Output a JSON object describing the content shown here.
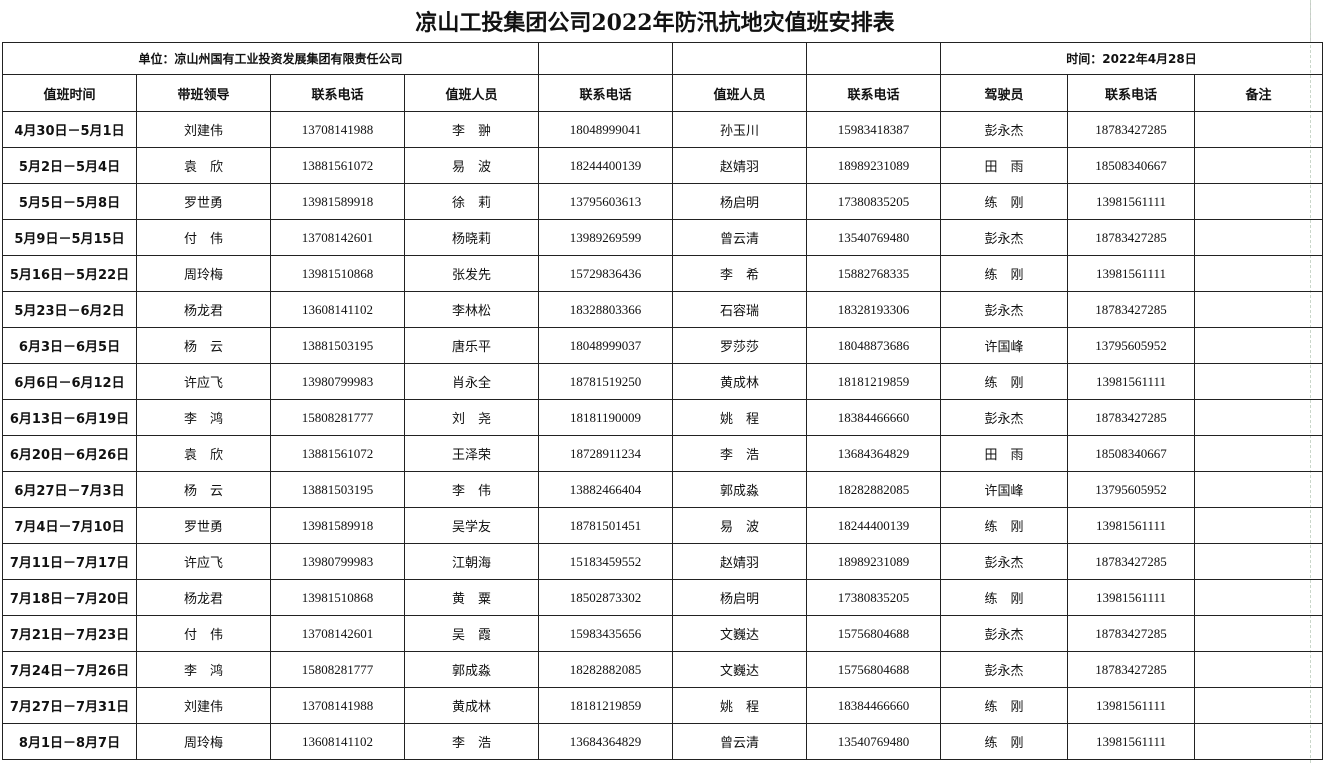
{
  "title": "凉山工投集团公司2022年防汛抗地灾值班安排表",
  "unit": "单位：凉山州国有工业投资发展集团有限责任公司",
  "date": "时间：2022年4月28日",
  "headers": [
    "值班时间",
    "带班领导",
    "联系电话",
    "值班人员",
    "联系电话",
    "值班人员",
    "联系电话",
    "驾驶员",
    "联系电话",
    "备注"
  ],
  "rows": [
    {
      "period": "4月30日－5月1日",
      "leader": "刘建伟",
      "leader_phone": "13708141988",
      "duty1": "李　翀",
      "duty1_phone": "18048999041",
      "duty2": "孙玉川",
      "duty2_phone": "15983418387",
      "driver": "彭永杰",
      "driver_phone": "18783427285",
      "note": ""
    },
    {
      "period": "5月2日－5月4日",
      "leader": "袁　欣",
      "leader_phone": "13881561072",
      "duty1": "易　波",
      "duty1_phone": "18244400139",
      "duty2": "赵婧羽",
      "duty2_phone": "18989231089",
      "driver": "田　雨",
      "driver_phone": "18508340667",
      "note": ""
    },
    {
      "period": "5月5日－5月8日",
      "leader": "罗世勇",
      "leader_phone": "13981589918",
      "duty1": "徐　莉",
      "duty1_phone": "13795603613",
      "duty2": "杨启明",
      "duty2_phone": "17380835205",
      "driver": "练　刚",
      "driver_phone": "13981561111",
      "note": ""
    },
    {
      "period": "5月9日－5月15日",
      "leader": "付　伟",
      "leader_phone": "13708142601",
      "duty1": "杨晓莉",
      "duty1_phone": "13989269599",
      "duty2": "曾云清",
      "duty2_phone": "13540769480",
      "driver": "彭永杰",
      "driver_phone": "18783427285",
      "note": ""
    },
    {
      "period": "5月16日－5月22日",
      "leader": "周玲梅",
      "leader_phone": "13981510868",
      "duty1": "张发先",
      "duty1_phone": "15729836436",
      "duty2": "李　希",
      "duty2_phone": "15882768335",
      "driver": "练　刚",
      "driver_phone": "13981561111",
      "note": ""
    },
    {
      "period": "5月23日－6月2日",
      "leader": "杨龙君",
      "leader_phone": "13608141102",
      "duty1": "李林松",
      "duty1_phone": "18328803366",
      "duty2": "石容瑞",
      "duty2_phone": "18328193306",
      "driver": "彭永杰",
      "driver_phone": "18783427285",
      "note": ""
    },
    {
      "period": "6月3日－6月5日",
      "leader": "杨　云",
      "leader_phone": "13881503195",
      "duty1": "唐乐平",
      "duty1_phone": "18048999037",
      "duty2": "罗莎莎",
      "duty2_phone": "18048873686",
      "driver": "许国峰",
      "driver_phone": "13795605952",
      "note": ""
    },
    {
      "period": "6月6日－6月12日",
      "leader": "许应飞",
      "leader_phone": "13980799983",
      "duty1": "肖永全",
      "duty1_phone": "18781519250",
      "duty2": "黄成林",
      "duty2_phone": "18181219859",
      "driver": "练　刚",
      "driver_phone": "13981561111",
      "note": ""
    },
    {
      "period": "6月13日－6月19日",
      "leader": "李　鸿",
      "leader_phone": "15808281777",
      "duty1": "刘　尧",
      "duty1_phone": "18181190009",
      "duty2": "姚　程",
      "duty2_phone": "18384466660",
      "driver": "彭永杰",
      "driver_phone": "18783427285",
      "note": ""
    },
    {
      "period": "6月20日－6月26日",
      "leader": "袁　欣",
      "leader_phone": "13881561072",
      "duty1": "王泽荣",
      "duty1_phone": "18728911234",
      "duty2": "李　浩",
      "duty2_phone": "13684364829",
      "driver": "田　雨",
      "driver_phone": "18508340667",
      "note": ""
    },
    {
      "period": "6月27日－7月3日",
      "leader": "杨　云",
      "leader_phone": "13881503195",
      "duty1": "李　伟",
      "duty1_phone": "13882466404",
      "duty2": "郭成淼",
      "duty2_phone": "18282882085",
      "driver": "许国峰",
      "driver_phone": "13795605952",
      "note": ""
    },
    {
      "period": "7月4日－7月10日",
      "leader": "罗世勇",
      "leader_phone": "13981589918",
      "duty1": "吴学友",
      "duty1_phone": "18781501451",
      "duty2": "易　波",
      "duty2_phone": "18244400139",
      "driver": "练　刚",
      "driver_phone": "13981561111",
      "note": ""
    },
    {
      "period": "7月11日－7月17日",
      "leader": "许应飞",
      "leader_phone": "13980799983",
      "duty1": "江朝海",
      "duty1_phone": "15183459552",
      "duty2": "赵婧羽",
      "duty2_phone": "18989231089",
      "driver": "彭永杰",
      "driver_phone": "18783427285",
      "note": ""
    },
    {
      "period": "7月18日－7月20日",
      "leader": "杨龙君",
      "leader_phone": "13981510868",
      "duty1": "黄　粟",
      "duty1_phone": "18502873302",
      "duty2": "杨启明",
      "duty2_phone": "17380835205",
      "driver": "练　刚",
      "driver_phone": "13981561111",
      "note": ""
    },
    {
      "period": "7月21日－7月23日",
      "leader": "付　伟",
      "leader_phone": "13708142601",
      "duty1": "吴　霞",
      "duty1_phone": "15983435656",
      "duty2": "文巍达",
      "duty2_phone": "15756804688",
      "driver": "彭永杰",
      "driver_phone": "18783427285",
      "note": ""
    },
    {
      "period": "7月24日－7月26日",
      "leader": "李　鸿",
      "leader_phone": "15808281777",
      "duty1": "郭成淼",
      "duty1_phone": "18282882085",
      "duty2": "文巍达",
      "duty2_phone": "15756804688",
      "driver": "彭永杰",
      "driver_phone": "18783427285",
      "note": ""
    },
    {
      "period": "7月27日－7月31日",
      "leader": "刘建伟",
      "leader_phone": "13708141988",
      "duty1": "黄成林",
      "duty1_phone": "18181219859",
      "duty2": "姚　程",
      "duty2_phone": "18384466660",
      "driver": "练　刚",
      "driver_phone": "13981561111",
      "note": ""
    },
    {
      "period": "8月1日－8月7日",
      "leader": "周玲梅",
      "leader_phone": "13608141102",
      "duty1": "李　浩",
      "duty1_phone": "13684364829",
      "duty2": "曾云清",
      "duty2_phone": "13540769480",
      "driver": "练　刚",
      "driver_phone": "13981561111",
      "note": ""
    }
  ]
}
